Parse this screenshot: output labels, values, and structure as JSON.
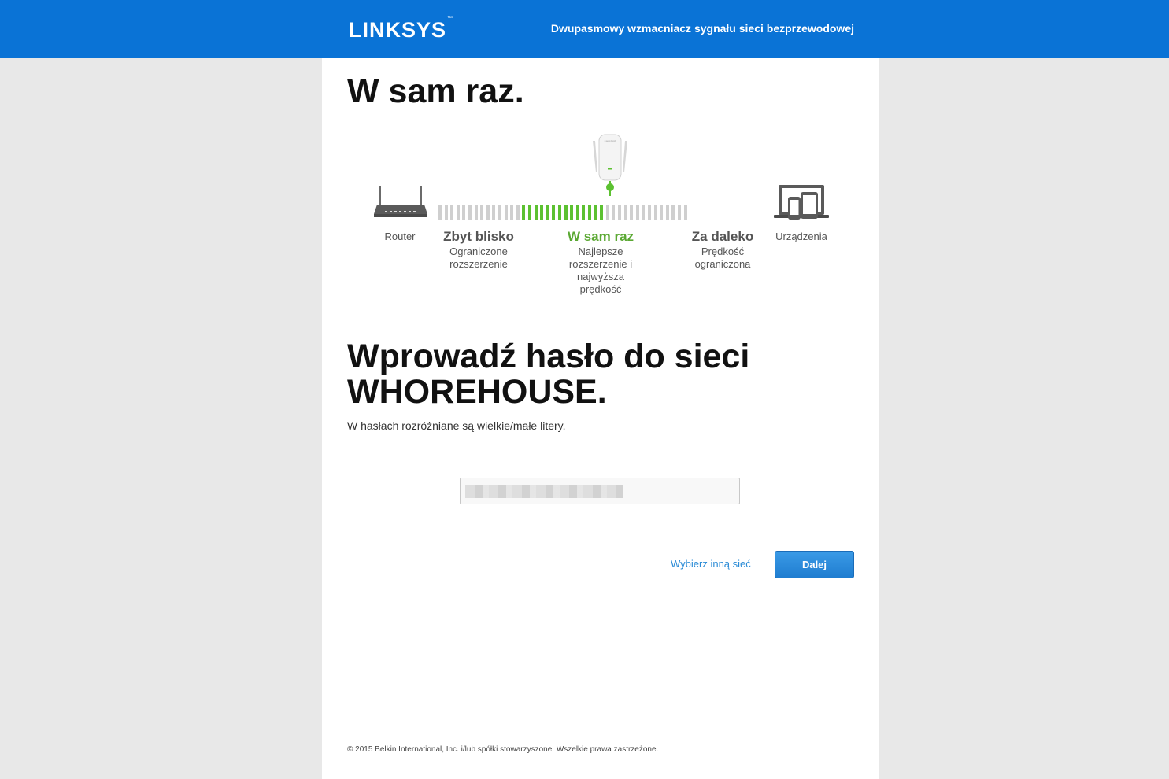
{
  "header": {
    "logo_text": "LINKSYS",
    "logo_tm": "™",
    "subtitle": "Dwupasmowy wzmacniacz sygnału sieci bezprzewodowej",
    "background_color": "#0a73d6"
  },
  "placement": {
    "title": "W sam raz.",
    "router_label": "Router",
    "devices_label": "Urządzenia",
    "zones": [
      {
        "title": "Zbyt blisko",
        "description": "Ograniczone rozszerzenie",
        "active": false
      },
      {
        "title": "W sam raz",
        "description": "Najlepsze rozszerzenie i najwyższa prędkość",
        "active": true
      },
      {
        "title": "Za daleko",
        "description": "Prędkość ograniczona",
        "active": false
      }
    ],
    "extender_logo": "LINKSYS",
    "active_color": "#5cc131",
    "inactive_color": "#cfcfcf"
  },
  "password": {
    "heading": "Wprowadź hasło do sieci WHOREHOUSE.",
    "hint": "W hasłach rozróżniane są wielkie/małe litery.",
    "value": ""
  },
  "actions": {
    "other_network_label": "Wybierz inną sieć",
    "next_label": "Dalej"
  },
  "footer": {
    "copyright": "© 2015 Belkin International, Inc. i/lub spółki stowarzyszone. Wszelkie prawa zastrzeżone."
  }
}
